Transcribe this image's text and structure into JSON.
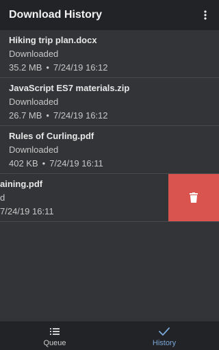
{
  "appbar": {
    "title": "Download History",
    "menu_icon": "more-vert-icon"
  },
  "downloads": [
    {
      "name": "Hiking trip plan.docx",
      "status": "Downloaded",
      "size": "35.2 MB",
      "separator": "•",
      "date": "7/24/19 16:12"
    },
    {
      "name": "JavaScript ES7 materials.zip",
      "status": "Downloaded",
      "size": "26.7 MB",
      "separator": "•",
      "date": "7/24/19 16:12"
    },
    {
      "name": "Rules of Curling.pdf",
      "status": "Downloaded",
      "size": "402 KB",
      "separator": "•",
      "date": "7/24/19 16:11"
    },
    {
      "name": "aining.pdf",
      "status": "d",
      "size": "",
      "separator": "",
      "date": "7/24/19 16:11",
      "swiped": true,
      "delete_icon": "trash-icon"
    }
  ],
  "bottom_nav": {
    "items": [
      {
        "label": "Queue",
        "icon": "queue-list-icon",
        "active": false
      },
      {
        "label": "History",
        "icon": "checkmark-icon",
        "active": true
      }
    ]
  },
  "colors": {
    "background": "#333437",
    "appbar": "#222326",
    "delete": "#d9534f",
    "accent": "#7ba7d9"
  }
}
